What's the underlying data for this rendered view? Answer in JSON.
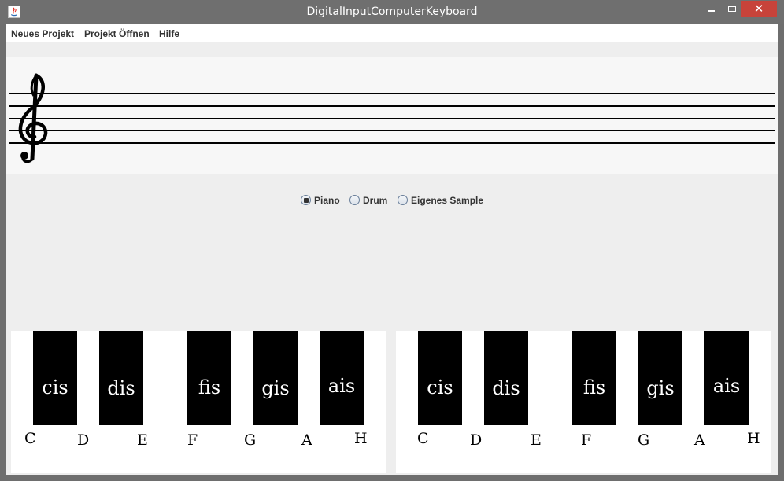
{
  "window": {
    "title": "DigitalInputComputerKeyboard",
    "close_label": "✕"
  },
  "menu": {
    "items": [
      {
        "label": "Neues Projekt"
      },
      {
        "label": "Projekt Öffnen"
      },
      {
        "label": "Hilfe"
      }
    ]
  },
  "instrument": {
    "options": [
      {
        "label": "Piano",
        "selected": true
      },
      {
        "label": "Drum",
        "selected": false
      },
      {
        "label": "Eigenes Sample",
        "selected": false
      }
    ]
  },
  "keyboards": [
    {
      "black_keys": [
        "cis",
        "dis",
        "fis",
        "gis",
        "ais"
      ],
      "white_keys": [
        "C",
        "D",
        "E",
        "F",
        "G",
        "A",
        "H"
      ]
    },
    {
      "black_keys": [
        "cis",
        "dis",
        "fis",
        "gis",
        "ais"
      ],
      "white_keys": [
        "C",
        "D",
        "E",
        "F",
        "G",
        "A",
        "H"
      ]
    }
  ],
  "icons": {
    "app": "java-icon",
    "clef": "treble-clef-icon"
  },
  "colors": {
    "titlebar": "#6f6f6f",
    "close_button": "#c7433a",
    "panel_background": "#eeeeee",
    "black_key": "#000000"
  }
}
